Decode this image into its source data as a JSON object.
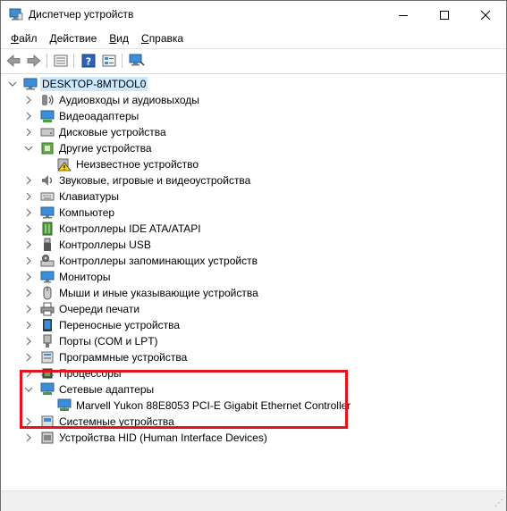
{
  "window": {
    "title": "Диспетчер устройств",
    "controls": {
      "minimize": "minimize",
      "maximize": "maximize",
      "close": "close"
    }
  },
  "menu": [
    {
      "label": "Файл",
      "accel": "Ф",
      "rest": "айл"
    },
    {
      "label": "Действие",
      "accel": "Д",
      "rest": "ействие"
    },
    {
      "label": "Вид",
      "accel": "В",
      "rest": "ид"
    },
    {
      "label": "Справка",
      "accel": "С",
      "rest": "правка"
    }
  ],
  "toolbar": {
    "buttons": [
      "back-icon",
      "forward-icon",
      "properties-icon",
      "help-icon",
      "show-hidden-icon",
      "scan-hardware-icon"
    ]
  },
  "tree": {
    "root": {
      "label": "DESKTOP-8MTDOL0",
      "expanded": true
    },
    "categories": [
      {
        "label": "Аудиовходы и аудиовыходы",
        "icon": "audio-io-icon"
      },
      {
        "label": "Видеоадаптеры",
        "icon": "display-adapter-icon"
      },
      {
        "label": "Дисковые устройства",
        "icon": "disk-drive-icon"
      },
      {
        "label": "Другие устройства",
        "icon": "other-devices-icon",
        "expanded": true,
        "children": [
          {
            "label": "Неизвестное устройство",
            "icon": "unknown-device-warning-icon"
          }
        ]
      },
      {
        "label": "Звуковые, игровые и видеоустройства",
        "icon": "sound-icon"
      },
      {
        "label": "Клавиатуры",
        "icon": "keyboard-icon"
      },
      {
        "label": "Компьютер",
        "icon": "computer-icon"
      },
      {
        "label": "Контроллеры IDE ATA/ATAPI",
        "icon": "ide-controller-icon"
      },
      {
        "label": "Контроллеры USB",
        "icon": "usb-icon"
      },
      {
        "label": "Контроллеры запоминающих устройств",
        "icon": "storage-controller-icon"
      },
      {
        "label": "Мониторы",
        "icon": "monitor-icon"
      },
      {
        "label": "Мыши и иные указывающие устройства",
        "icon": "mouse-icon"
      },
      {
        "label": "Очереди печати",
        "icon": "print-queue-icon"
      },
      {
        "label": "Переносные устройства",
        "icon": "portable-device-icon"
      },
      {
        "label": "Порты (COM и LPT)",
        "icon": "port-icon"
      },
      {
        "label": "Программные устройства",
        "icon": "software-device-icon"
      },
      {
        "label": "Процессоры",
        "icon": "processor-icon"
      },
      {
        "label": "Сетевые адаптеры",
        "icon": "network-adapter-icon",
        "expanded": true,
        "children": [
          {
            "label": "Marvell Yukon 88E8053 PCI-E Gigabit Ethernet Controller",
            "icon": "network-adapter-icon"
          }
        ]
      },
      {
        "label": "Системные устройства",
        "icon": "system-device-icon"
      },
      {
        "label": "Устройства HID (Human Interface Devices)",
        "icon": "hid-icon"
      }
    ]
  },
  "colors": {
    "selection": "#cce8ff",
    "highlight_box": "#e3141d",
    "expander": "#6d6d6d"
  }
}
